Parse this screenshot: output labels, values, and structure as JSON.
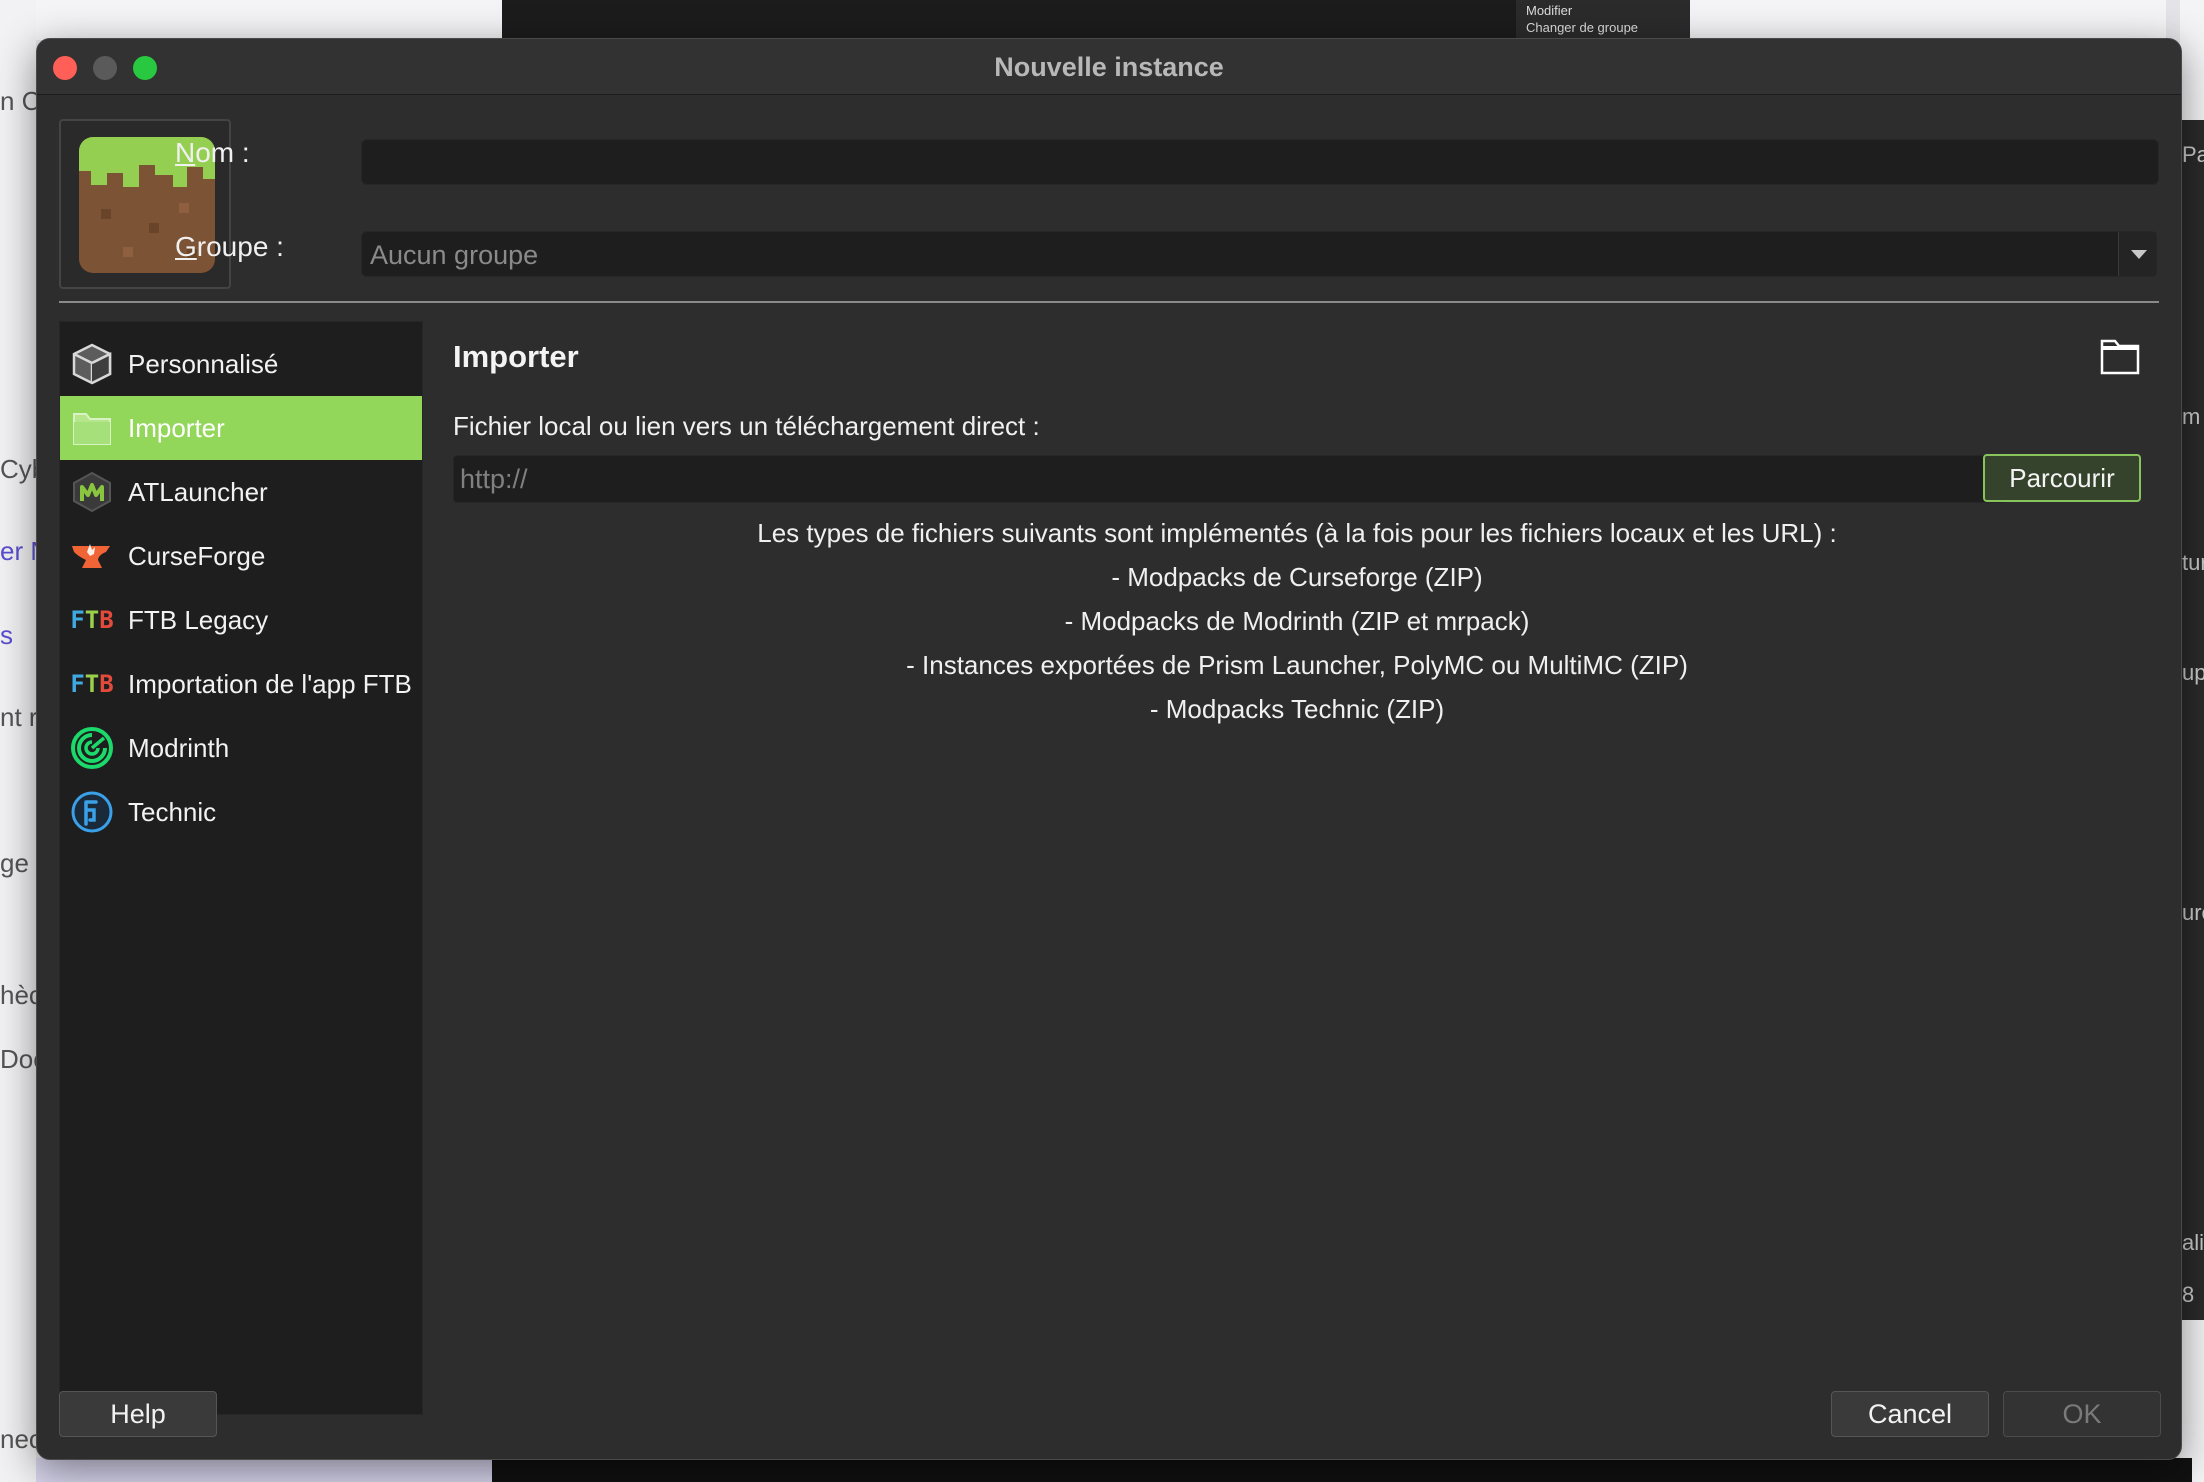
{
  "window": {
    "title": "Nouvelle instance"
  },
  "form": {
    "name_label_prefix": "N",
    "name_label_rest": "om :",
    "name_value": "",
    "group_label_prefix": "G",
    "group_label_rest": "roupe :",
    "group_value": "Aucun groupe"
  },
  "sidebar": {
    "items": [
      {
        "label": "Personnalisé",
        "icon": "cube-icon",
        "active": false
      },
      {
        "label": "Importer",
        "icon": "folder-icon",
        "active": true
      },
      {
        "label": "ATLauncher",
        "icon": "atlauncher-icon",
        "active": false
      },
      {
        "label": "CurseForge",
        "icon": "curseforge-anvil-icon",
        "active": false
      },
      {
        "label": "FTB Legacy",
        "icon": "ftb-icon",
        "active": false
      },
      {
        "label": "Importation de l'app FTB",
        "icon": "ftb-icon",
        "active": false
      },
      {
        "label": "Modrinth",
        "icon": "modrinth-icon",
        "active": false
      },
      {
        "label": "Technic",
        "icon": "technic-icon",
        "active": false
      }
    ],
    "ftb_text": "FTB"
  },
  "content": {
    "title": "Importer",
    "field_label": "Fichier local ou lien vers un téléchargement direct :",
    "url_placeholder": "http://",
    "url_value": "",
    "browse_label": "Parcourir",
    "info_lines": [
      "Les types de fichiers suivants sont implémentés (à la fois pour les fichiers locaux et les URL) :",
      "- Modpacks de Curseforge (ZIP)",
      "- Modpacks de Modrinth (ZIP et mrpack)",
      "- Instances exportées de Prism Launcher, PolyMC ou MultiMC (ZIP)",
      "- Modpacks Technic (ZIP)"
    ]
  },
  "buttons": {
    "help": "Help",
    "cancel": "Cancel",
    "ok": "OK"
  },
  "background": {
    "left_fragments": [
      "n Cy",
      "Cyb",
      "er N",
      "s",
      "nt r",
      "ge",
      "hèc",
      "Doc",
      "nec"
    ],
    "right_fragments": [
      "Pac",
      "m",
      "tur",
      "up",
      "urc",
      "ali",
      "8"
    ],
    "menu_items": [
      "Modifier",
      "Changer de groupe"
    ]
  },
  "colors": {
    "accent": "#93d75a",
    "window_bg": "#2d2d2d",
    "field_bg": "#1e1e1e"
  }
}
